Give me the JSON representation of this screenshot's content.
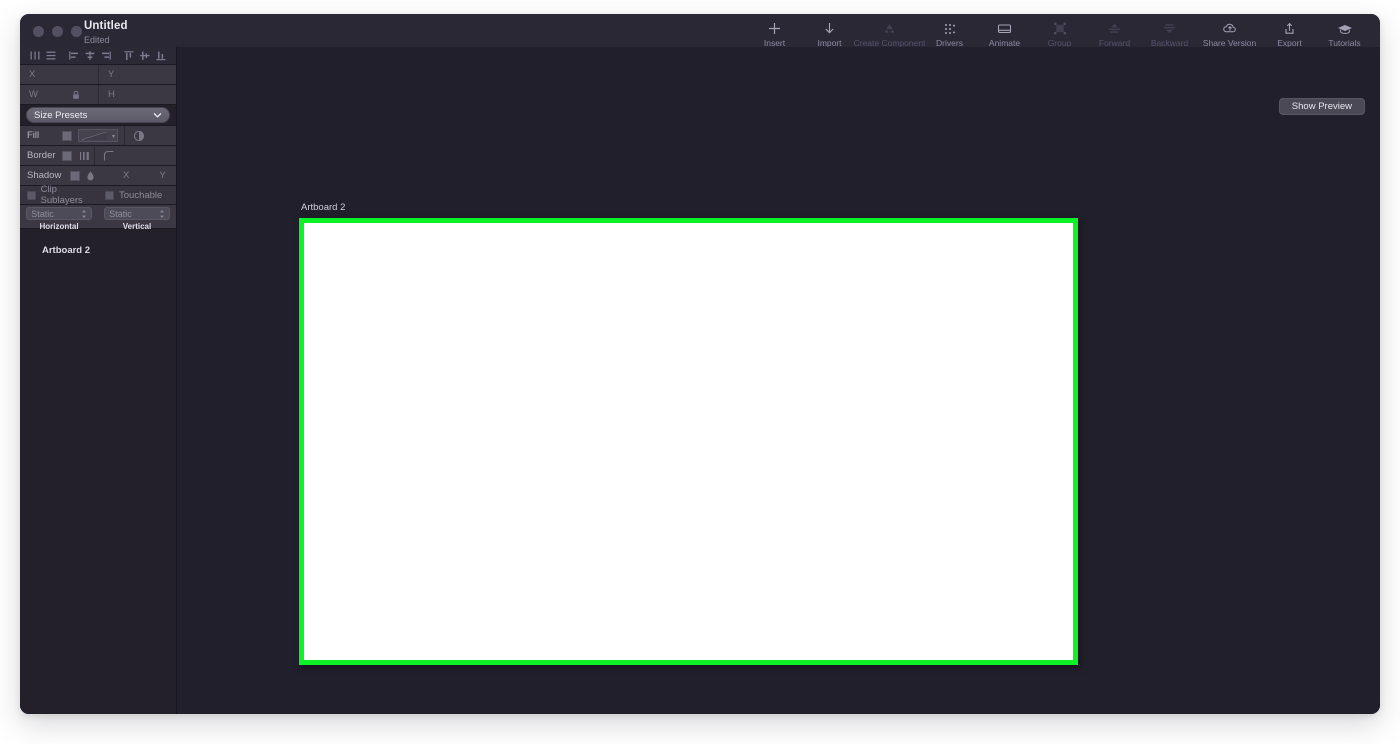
{
  "window": {
    "title": "Untitled",
    "subtitle": "Edited",
    "traffic_lights": [
      "close",
      "minimize",
      "zoom"
    ]
  },
  "toolbar": {
    "items": [
      {
        "label": "Insert",
        "icon": "plus-icon",
        "enabled": true
      },
      {
        "label": "Import",
        "icon": "download-arrow-icon",
        "enabled": true
      },
      {
        "label": "Create Component",
        "icon": "component-icon",
        "enabled": false
      },
      {
        "label": "Drivers",
        "icon": "drivers-dots-icon",
        "enabled": true
      },
      {
        "label": "Animate",
        "icon": "animate-icon",
        "enabled": true
      },
      {
        "label": "Group",
        "icon": "group-icon",
        "enabled": false
      },
      {
        "label": "Forward",
        "icon": "bring-forward-icon",
        "enabled": false
      },
      {
        "label": "Backward",
        "icon": "send-backward-icon",
        "enabled": false
      },
      {
        "label": "Share Version",
        "icon": "cloud-upload-icon",
        "enabled": true
      },
      {
        "label": "Export",
        "icon": "export-share-icon",
        "enabled": true
      },
      {
        "label": "Tutorials",
        "icon": "graduation-cap-icon",
        "enabled": true
      }
    ]
  },
  "inspector": {
    "align_tools": [
      "distribute-horizontally-icon",
      "distribute-vertically-icon",
      "align-left-icon",
      "align-center-horizontal-icon",
      "align-right-icon",
      "align-top-icon",
      "align-center-vertical-icon",
      "align-bottom-icon"
    ],
    "position": {
      "x_label": "X",
      "x_value": "",
      "y_label": "Y",
      "y_value": ""
    },
    "size": {
      "w_label": "W",
      "w_value": "",
      "h_label": "H",
      "h_value": "",
      "lock_icon": "lock-icon"
    },
    "size_presets": {
      "label": "Size Presets",
      "caret": "chevron-down-icon"
    },
    "fill": {
      "label": "Fill",
      "swatch_color": "#6c6978",
      "gradient_icon": "gradient-icon",
      "blend_icon": "blend-mode-icon"
    },
    "border": {
      "label": "Border",
      "swatch_color": "#6c6978",
      "width_icon": "border-width-icon",
      "corner_icon": "corner-radius-icon"
    },
    "shadow": {
      "label": "Shadow",
      "swatch_color": "#6c6978",
      "blur_icon": "shadow-drop-icon",
      "x_label": "X",
      "x_value": "",
      "y_label": "Y",
      "y_value": ""
    },
    "toggles": [
      {
        "label": "Clip Sublayers",
        "checked": false
      },
      {
        "label": "Touchable",
        "checked": false
      }
    ],
    "layout": [
      {
        "value": "Static",
        "caption": "Horizontal"
      },
      {
        "value": "Static",
        "caption": "Vertical"
      }
    ]
  },
  "layers": {
    "items": [
      {
        "name": "Artboard 2"
      }
    ]
  },
  "canvas": {
    "show_preview_label": "Show Preview",
    "artboard": {
      "name": "Artboard 2",
      "fill_color": "#ffffff",
      "selection_color": "#0df226"
    }
  }
}
